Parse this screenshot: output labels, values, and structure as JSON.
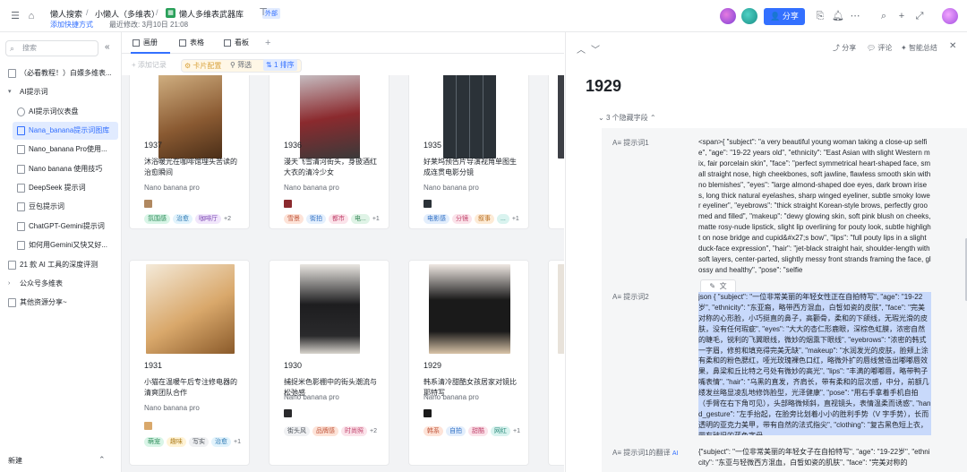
{
  "topbar": {
    "breadcrumb": [
      "懒人搜索",
      "小懒人（多维表）",
      "懒人多维表武器库"
    ],
    "share_badge": "外部",
    "add_shortcut": "添加快捷方式",
    "last_modified": "最近修改: 3月10日 21:08",
    "share_label": "分享"
  },
  "sidebar": {
    "search_placeholder": "搜索",
    "items": [
      {
        "label": "（必看教程！）白嫖多维表...",
        "icon": "doc-icon"
      },
      {
        "label": "AI提示词",
        "icon": "caret-down-icon"
      },
      {
        "label": "AI提示词仪表盘",
        "icon": "dashboard-icon"
      },
      {
        "label": "Nana_banana提示词图库",
        "icon": "table-icon"
      },
      {
        "label": "Nano_banana Pro使用...",
        "icon": "doc-icon"
      },
      {
        "label": "Nano banana 使用技巧",
        "icon": "doc-icon"
      },
      {
        "label": "DeepSeek 提示词",
        "icon": "table-icon"
      },
      {
        "label": "豆包提示词",
        "icon": "table-icon"
      },
      {
        "label": "ChatGPT-Gemini提示词",
        "icon": "table-icon"
      },
      {
        "label": "如何用Gemini又快又好...",
        "icon": "doc-icon"
      },
      {
        "label": "21 款 AI 工具的深度评测",
        "icon": "doc-icon"
      },
      {
        "label": "公众号多维表",
        "icon": "caret-right-icon"
      },
      {
        "label": "其他资源分享~",
        "icon": "doc-icon"
      }
    ],
    "new_label": "新建"
  },
  "views": {
    "tabs": [
      "画册",
      "表格",
      "看板"
    ],
    "add": "+"
  },
  "toolbar": {
    "add_record": "+ 添加记录",
    "card_config": "卡片配置",
    "filter": "筛选",
    "sort": "1 排序"
  },
  "cards": [
    {
      "num": "1937",
      "title": "沐浴暖光在咖啡馆埋头苦读的治愈瞬间",
      "model": "Nano banana pro",
      "tags": [
        "氛围感",
        "治愈",
        "咖啡厅"
      ],
      "more": "+2"
    },
    {
      "num": "1936",
      "title": "漫天飞雪清河街头，身披酒红大衣的清冷少女",
      "model": "Nano banana pro",
      "tags": [
        "雪景",
        "街拍",
        "都市",
        "电..."
      ],
      "more": "+1"
    },
    {
      "num": "1935",
      "title": "好莱坞预告片导演视角单图生成连贯电影分镜",
      "model": "Nano banana pro",
      "tags": [
        "电影感",
        "分镜",
        "叙事",
        "..."
      ],
      "more": "+1"
    },
    {
      "num": "1931",
      "title": "小猫在温暖午后专注修电器的清爽团队合作",
      "model": "Nano banana pro",
      "tags": [
        "萌宠",
        "趣味",
        "写实",
        "治愈"
      ],
      "more": "+1"
    },
    {
      "num": "1930",
      "title": "捕捉米色影棚中的街头潮流与松弛感",
      "model": "Nano banana pro",
      "tags": [
        "街头风",
        "品牌感",
        "时尚照"
      ],
      "more": "+2"
    },
    {
      "num": "1929",
      "title": "韩系清冷甜酷女孩居家对镜比耶特写",
      "model": "Nano banana pro",
      "tags": [
        "韩系",
        "自拍",
        "甜酷",
        "网红"
      ],
      "more": "+1"
    }
  ],
  "detail": {
    "title": "1929",
    "share": "分享",
    "comment": "评论",
    "summary": "智能总结",
    "hidden_fields": "3 个隐藏字段",
    "field1_name": "提示词1",
    "field1_value": "<span>{ \"subject\": \"a very beautiful young woman taking a close-up selfie\", \"age\": \"19-22 years old\", \"ethnicity\": \"East Asian with slight Western mix, fair porcelain skin\", \"face\": \"perfect symmetrical heart-shaped face, small straight nose, high cheekbones, soft jawline, flawless smooth skin with no blemishes\", \"eyes\": \"large almond-shaped doe eyes, dark brown irises, long thick natural eyelashes, sharp winged eyeliner, subtle smoky lower eyeliner\", \"eyebrows\": \"thick straight Korean-style brows, perfectly groomed and filled\", \"makeup\": \"dewy glowing skin, soft pink blush on cheeks, matte rosy-nude lipstick, slight lip overlining for pouty look, subtle highlight on nose bridge and cupid&#x27;s bow\", \"lips\": \"full pouty lips in a slight duck-face expression\", \"hair\": \"jet-black straight hair, shoulder-length with soft layers, center-parted, slightly messy front strands framing the face, glossy and healthy\", \"pose\": \"selfie",
    "field2_name": "提示词2",
    "field2_value": "json { \"subject\": \"一位非常美丽的年轻女性正在自拍特写\", \"age\": \"19-22岁\", \"ethnicity\": \"东亚裔，略带西方混血，白皙如瓷的皮肤\", \"face\": \"完美对称的心形脸，小巧挺直的鼻子，高颧骨，柔和的下颌线，无瑕光滑的皮肤，没有任何瑕疵\", \"eyes\": \"大大的杏仁形鹿眼，深棕色虹膜，浓密自然的睫毛，锐利的飞翼眼线，微妙的烟熏下眼线\", \"eyebrows\": \"浓密的韩式一字眉，修剪和填充得完美无缺\", \"makeup\": \"水润发光的皮肤，脸颊上涂有柔和的粉色腮红，哑光玫瑰裸色口红，略微外扩的唇线营造出嘟嘟唇效果，鼻梁和丘比特之弓处有微妙的高光\", \"lips\": \"丰满的嘟嘟唇，略带鸭子嘴表情\", \"hair\": \"乌黑的直发，齐肩长，带有柔和的层次感，中分，前额几缕发丝略显凌乱地修饰脸型，光泽健康\", \"pose\": \"用右手拿着手机自拍（手臂在右下角可见），头部略微倾斜，直视镜头，表情温柔而诱惑\", \"hand_gesture\": \"左手抬起，在脸旁比划着小小的胜利手势（V 字手势），长而透明的亚克力美甲，带有自然的法式指尖\", \"clothing\": \"复古黑色短上衣，带有破旧的蓝色字母",
    "field3_name": "提示词1的翻译",
    "field3_ai": "AI",
    "field3_value": "{\"subject\": \"一位非常美丽的年轻女子在自拍特写\", \"age\": \"19-22岁\", \"ethnicity\": \"东亚与轻微西方混血，白皙如瓷的肌肤\", \"face\": \"完美对称的"
  },
  "colors": {
    "accent": "#3370ff",
    "selection": "#c8d9fb",
    "gallery_bg": "#f2f3f5"
  }
}
